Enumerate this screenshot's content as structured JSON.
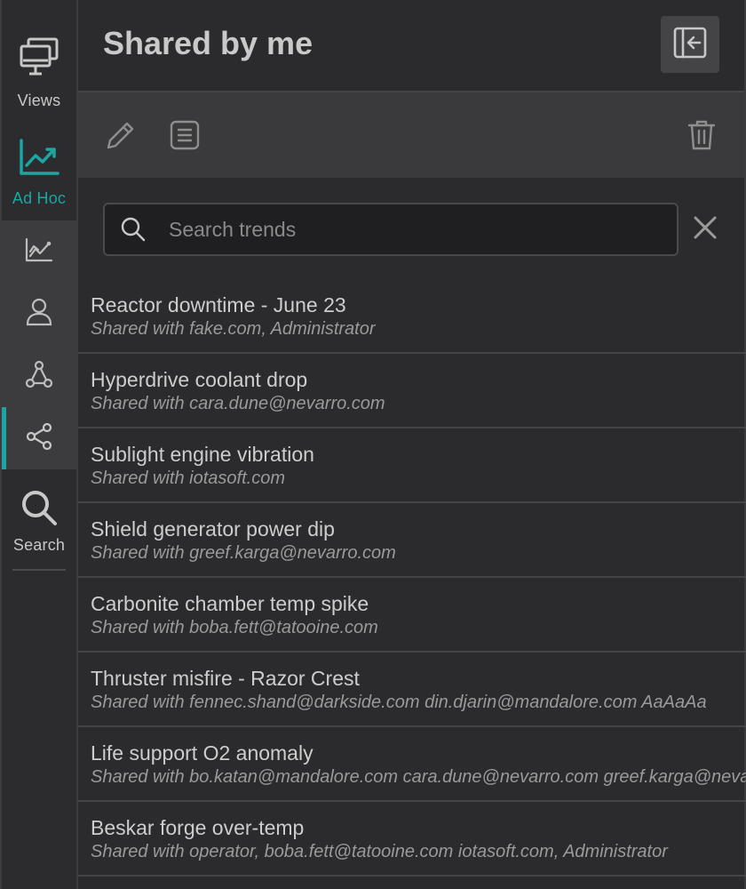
{
  "rail": {
    "views_label": "Views",
    "adhoc_label": "Ad Hoc",
    "search_label": "Search",
    "accent_color": "#1ba6a3",
    "sub_items": [
      {
        "icon": "line-chart-icon"
      },
      {
        "icon": "user-icon"
      },
      {
        "icon": "network-icon"
      },
      {
        "icon": "share-icon",
        "active": true
      }
    ]
  },
  "header": {
    "title": "Shared by me"
  },
  "search": {
    "placeholder": "Search trends",
    "value": ""
  },
  "trends": [
    {
      "name": "Reactor downtime - June 23",
      "shared": "Shared with fake.com, Administrator"
    },
    {
      "name": "Hyperdrive coolant drop",
      "shared": "Shared with cara.dune@nevarro.com"
    },
    {
      "name": "Sublight engine vibration",
      "shared": "Shared with iotasoft.com"
    },
    {
      "name": "Shield generator power dip",
      "shared": "Shared with greef.karga@nevarro.com"
    },
    {
      "name": "Carbonite chamber temp spike",
      "shared": "Shared with boba.fett@tatooine.com"
    },
    {
      "name": "Thruster misfire - Razor Crest",
      "shared": "Shared with fennec.shand@darkside.com din.djarin@mandalore.com AaAaAa"
    },
    {
      "name": "Life support O2 anomaly",
      "shared": "Shared with bo.katan@mandalore.com cara.dune@nevarro.com greef.karga@nevarro.com"
    },
    {
      "name": "Beskar forge over-temp",
      "shared": "Shared with operator, boba.fett@tatooine.com iotasoft.com, Administrator"
    }
  ]
}
